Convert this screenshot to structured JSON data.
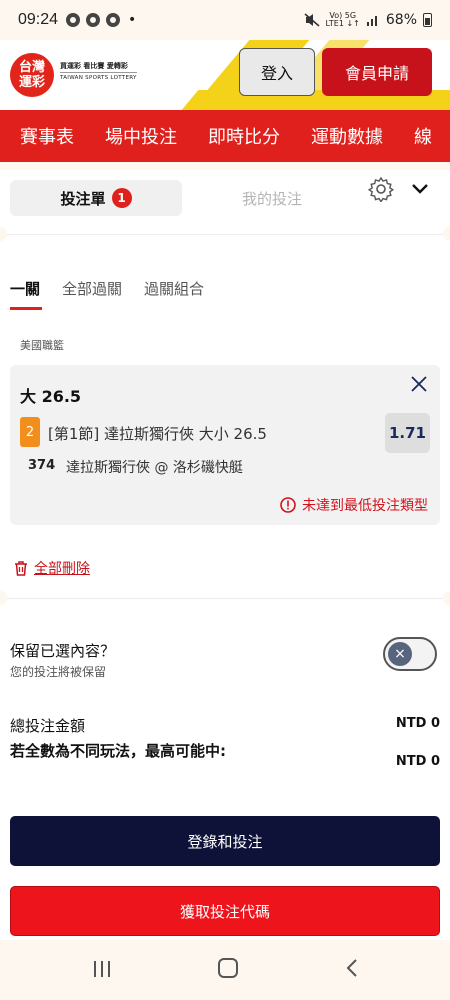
{
  "status_bar": {
    "time": "09:24",
    "dot": "•",
    "network": "Vo) 5G",
    "network_sub": "LTE1 ↓↑",
    "battery": "68%"
  },
  "header": {
    "logo_line1": "台灣",
    "logo_line2": "運彩",
    "tagline": "買運彩 看比賽 愛轉彩",
    "tagline_en": "TAIWAN SPORTS LOTTERY",
    "login_label": "登入",
    "register_label": "會員申請"
  },
  "nav": {
    "items": [
      "賽事表",
      "場中投注",
      "即時比分",
      "運動數據",
      "線"
    ]
  },
  "betslip": {
    "tab_active": "投注單",
    "badge": "1",
    "tab_inactive": "我的投注"
  },
  "bet_types": {
    "tabs": [
      "一關",
      "全部過關",
      "過關組合"
    ]
  },
  "selection": {
    "league": "美國職籃",
    "title": "大 26.5",
    "number": "2",
    "description": "[第1節] 達拉斯獨行俠 大小 26.5",
    "odds": "1.71",
    "match_id": "374",
    "match_name": "達拉斯獨行俠 @ 洛杉磯快艇",
    "warning": "未達到最低投注類型"
  },
  "actions": {
    "delete_all": "全部刪除"
  },
  "keep": {
    "title": "保留已選內容？",
    "subtitle": "您的投注將被保留"
  },
  "summary": {
    "total_label": "總投注金額",
    "total_value": "NTD 0",
    "max_label": "若全數為不同玩法，最高可能中:",
    "max_value": "NTD 0"
  },
  "buttons": {
    "login_bet": "登錄和投注",
    "get_code": "獲取投注代碼"
  },
  "colors": {
    "brand_red": "#e0201c",
    "navy": "#0e1238",
    "accent_yellow": "#f5d21a",
    "selection_orange": "#f28f1c"
  }
}
